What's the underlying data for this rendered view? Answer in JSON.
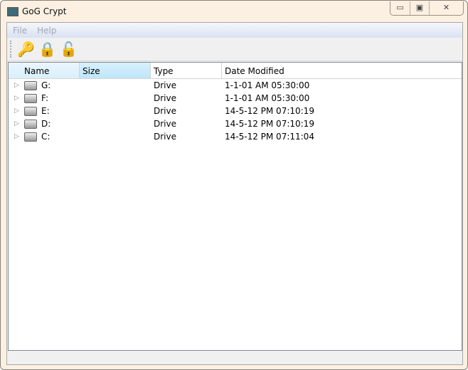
{
  "window": {
    "title": "GoG Crypt"
  },
  "menu": [
    "File",
    "Help"
  ],
  "toolbar": {
    "icons": [
      "key-icon",
      "lock-icon",
      "unlock-icon"
    ]
  },
  "columns": [
    "Name",
    "Size",
    "Type",
    "Date Modified"
  ],
  "rows": [
    {
      "name": "G:",
      "size": "",
      "type": "Drive",
      "date": "1-1-01 AM 05:30:00"
    },
    {
      "name": "F:",
      "size": "",
      "type": "Drive",
      "date": "1-1-01 AM 05:30:00"
    },
    {
      "name": "E:",
      "size": "",
      "type": "Drive",
      "date": "14-5-12 PM 07:10:19"
    },
    {
      "name": "D:",
      "size": "",
      "type": "Drive",
      "date": "14-5-12 PM 07:10:19"
    },
    {
      "name": "C:",
      "size": "",
      "type": "Drive",
      "date": "14-5-12 PM 07:11:04"
    }
  ]
}
